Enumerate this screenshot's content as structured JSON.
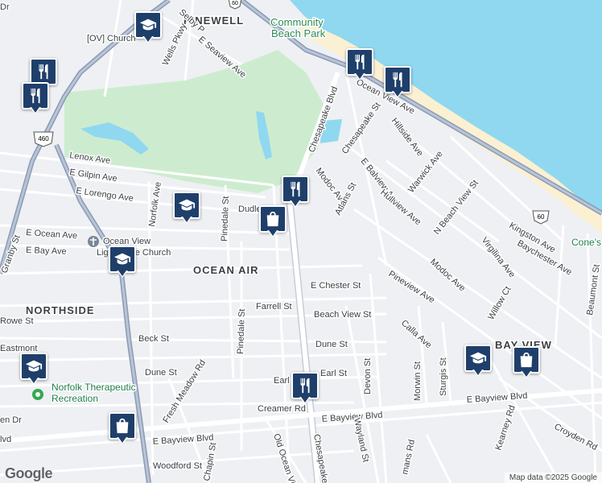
{
  "map": {
    "colors": {
      "water": "#8fd8f0",
      "park": "#cdeccf",
      "land": "#eef0f3",
      "road": "#ffffff",
      "highway": "#8a9bb5",
      "beach": "#fbf0d2",
      "marker": "#1f3f6b"
    },
    "areas": {
      "pinewell": "PINEWELL",
      "ocean_air": "OCEAN AIR",
      "northside": "NORTHSIDE",
      "bay_view": "BAY VIEW"
    },
    "parks": {
      "community_beach_park_1": "Community",
      "community_beach_park_2": "Beach Park"
    },
    "places": {
      "ov_church": "[OV] Church",
      "ocean_view_church_1": "Ocean View",
      "ocean_view_church_2": "Lighthouse Church",
      "norfolk_therapeutic_1": "Norfolk Therapeutic",
      "norfolk_therapeutic_2": "Recreation",
      "cones": "Cone's"
    },
    "shields": {
      "us60": "60",
      "us460": "460"
    },
    "streets": {
      "selby": "Selby P",
      "ocean_view_ave": "Ocean View Ave",
      "wells": "Wells Pkwy",
      "e_seaview": "E Seaview Ave",
      "chesapeake_blvd_n": "Chesapeake Blvd",
      "chesapeake_st": "Chesapeake St",
      "hillside": "Hillside Ave",
      "warwick": "Warwick Ave",
      "e_balview": "E Balview Ave",
      "modoc_n": "Modoc Ave",
      "atlans": "Atlans St",
      "hullview": "Hullview Ave",
      "n_beach_view": "N Beach View St",
      "kingston": "Kingston Ave",
      "baychester": "Baychester Ave",
      "virgilina": "Virgilina Ave",
      "modoc_s": "Modoc Ave",
      "willow": "Willow Ct",
      "beaumont": "Beaumont St",
      "pineview": "Pineview Ave",
      "lenox": "Lenox Ave",
      "e_gilpin": "E Gilpin Ave",
      "e_lorengo": "E Lorengo Ave",
      "norfolk_ave": "Norfolk Ave",
      "pinedale_n": "Pinedale St",
      "dudley": "Dudley",
      "e_ocean": "E Ocean Ave",
      "e_bay": "E Bay Ave",
      "granby": "Granby St",
      "e_chester": "E Chester St",
      "farrell": "Farrell St",
      "beach_view": "Beach View St",
      "calla": "Calla Ave",
      "rowe": "Rowe St",
      "beck": "Beck St",
      "dune_e": "Dune St",
      "dune_w": "Dune St",
      "pinedale_s": "Pinedale St",
      "eastmont": "Eastmont",
      "fresh_meadow": "Fresh Meadow Rd",
      "earl_w": "Earl",
      "earl_e": "Earl St",
      "devon": "Devon St",
      "morwin": "Morwin St",
      "sturgis": "Sturgis St",
      "creamer": "Creamer Rd",
      "e_bayview_w": "E Bayview Blvd",
      "e_bayview_c": "E Bayview Blvd",
      "e_bayview_e": "E Bayview Blvd",
      "kearney": "Kearney Rd",
      "croyden": "Croyden Rd",
      "woodford": "Woodford St",
      "chapin": "Chapin St",
      "old_ocean_view": "Old Ocean View",
      "chesapeake_s": "Chesapeake",
      "wayland": "Wayland St",
      "mans": "mans Rd",
      "en_dr": "en Dr",
      "lvd": "lvd",
      "dr_edge": "Dr",
      "ranby": "Granby"
    },
    "markers": [
      {
        "type": "restaurant",
        "icon": "fork-knife-icon"
      },
      {
        "type": "restaurant",
        "icon": "fork-knife-icon"
      },
      {
        "type": "restaurant",
        "icon": "fork-knife-icon"
      },
      {
        "type": "restaurant",
        "icon": "fork-knife-icon"
      },
      {
        "type": "restaurant",
        "icon": "fork-knife-icon"
      },
      {
        "type": "restaurant",
        "icon": "fork-knife-icon"
      },
      {
        "type": "school",
        "icon": "graduation-cap-icon"
      },
      {
        "type": "school",
        "icon": "graduation-cap-icon"
      },
      {
        "type": "school",
        "icon": "graduation-cap-icon"
      },
      {
        "type": "school",
        "icon": "graduation-cap-icon"
      },
      {
        "type": "school",
        "icon": "graduation-cap-icon"
      },
      {
        "type": "shopping",
        "icon": "shopping-bag-icon"
      },
      {
        "type": "shopping",
        "icon": "shopping-bag-icon"
      },
      {
        "type": "shopping",
        "icon": "shopping-bag-icon"
      }
    ]
  },
  "footer": {
    "logo": "Google",
    "attribution": "Map data ©2025 Google"
  }
}
